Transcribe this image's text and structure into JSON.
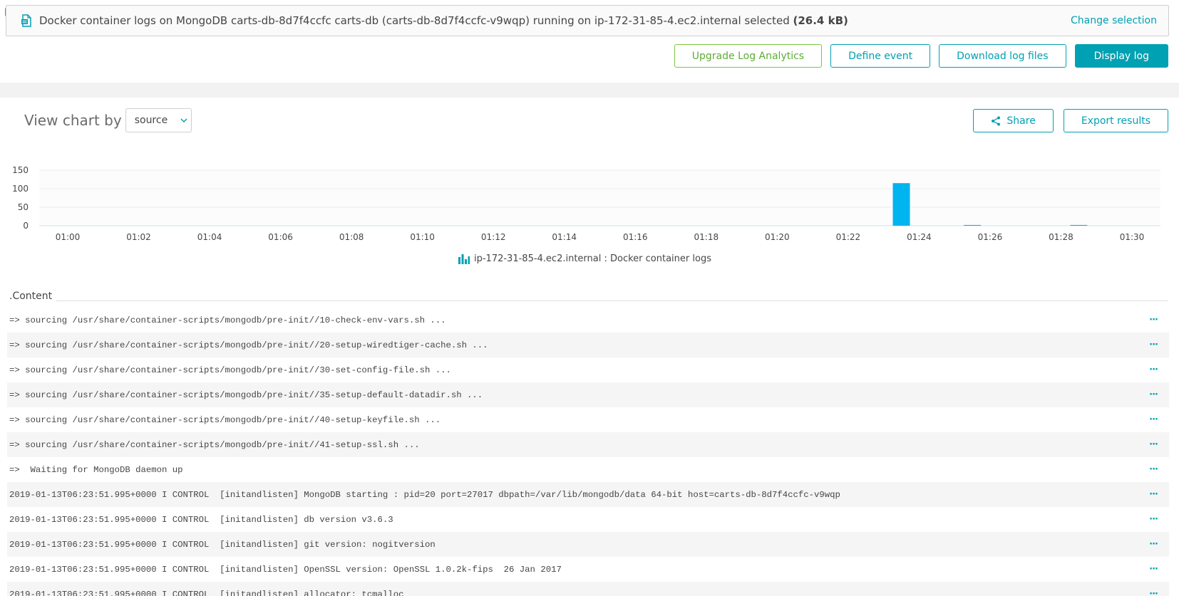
{
  "selection": {
    "text": "Docker container logs on MongoDB carts-db-8d7f4ccfc carts-db (carts-db-8d7f4ccfc-v9wqp) running on ip-172-31-85-4.ec2.internal selected",
    "size": "(26.4 kB)",
    "change_label": "Change selection"
  },
  "actions": {
    "upgrade": "Upgrade Log Analytics",
    "define_event": "Define event",
    "download": "Download log files",
    "display": "Display log"
  },
  "chart_controls": {
    "view_label": "View chart by",
    "select_value": "source",
    "share": "Share",
    "export": "Export results"
  },
  "legend": {
    "label": "ip-172-31-85-4.ec2.internal : Docker container logs"
  },
  "colors": {
    "accent": "#00a1b2",
    "bar": "#00b4f0",
    "green": "#7dc540"
  },
  "chart_data": {
    "type": "bar",
    "categories": [
      "01:00",
      "01:01",
      "01:02",
      "01:03",
      "01:04",
      "01:05",
      "01:06",
      "01:07",
      "01:08",
      "01:09",
      "01:10",
      "01:11",
      "01:12",
      "01:13",
      "01:14",
      "01:15",
      "01:16",
      "01:17",
      "01:18",
      "01:19",
      "01:20",
      "01:21",
      "01:22",
      "01:23",
      "01:24",
      "01:25",
      "01:26",
      "01:27",
      "01:28",
      "01:29",
      "01:30"
    ],
    "values": [
      0,
      0,
      0,
      0,
      0,
      0,
      0,
      0,
      0,
      0,
      0,
      0,
      0,
      0,
      0,
      0,
      0,
      0,
      0,
      0,
      0,
      0,
      0,
      115,
      0,
      2,
      0,
      0,
      2,
      0,
      0
    ],
    "x_tick_labels": [
      "01:00",
      "01:02",
      "01:04",
      "01:06",
      "01:08",
      "01:10",
      "01:12",
      "01:14",
      "01:16",
      "01:18",
      "01:20",
      "01:22",
      "01:24",
      "01:26",
      "01:28",
      "01:30"
    ],
    "y_tick_labels": [
      "150",
      "100",
      "50",
      "0"
    ],
    "ylim": [
      0,
      150
    ],
    "grid": true,
    "legend": "bottom-center",
    "series": [
      {
        "name": "ip-172-31-85-4.ec2.internal : Docker container logs"
      }
    ]
  },
  "content": {
    "title": ".Content",
    "more_label": "···",
    "rows": [
      "=> sourcing /usr/share/container-scripts/mongodb/pre-init//10-check-env-vars.sh ...",
      "=> sourcing /usr/share/container-scripts/mongodb/pre-init//20-setup-wiredtiger-cache.sh ...",
      "=> sourcing /usr/share/container-scripts/mongodb/pre-init//30-set-config-file.sh ...",
      "=> sourcing /usr/share/container-scripts/mongodb/pre-init//35-setup-default-datadir.sh ...",
      "=> sourcing /usr/share/container-scripts/mongodb/pre-init//40-setup-keyfile.sh ...",
      "=> sourcing /usr/share/container-scripts/mongodb/pre-init//41-setup-ssl.sh ...",
      "=>  Waiting for MongoDB daemon up",
      "2019-01-13T06:23:51.995+0000 I CONTROL  [initandlisten] MongoDB starting : pid=20 port=27017 dbpath=/var/lib/mongodb/data 64-bit host=carts-db-8d7f4ccfc-v9wqp",
      "2019-01-13T06:23:51.995+0000 I CONTROL  [initandlisten] db version v3.6.3",
      "2019-01-13T06:23:51.995+0000 I CONTROL  [initandlisten] git version: nogitversion",
      "2019-01-13T06:23:51.995+0000 I CONTROL  [initandlisten] OpenSSL version: OpenSSL 1.0.2k-fips  26 Jan 2017",
      "2019-01-13T06:23:51.995+0000 I CONTROL  [initandlisten] allocator: tcmalloc"
    ]
  }
}
